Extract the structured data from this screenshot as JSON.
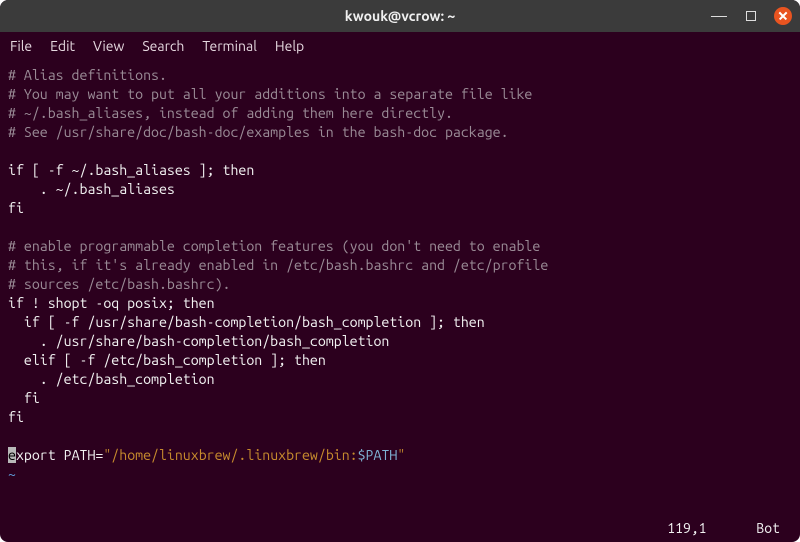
{
  "titlebar": {
    "title": "kwouk@vcrow: ~"
  },
  "menubar": {
    "items": [
      "File",
      "Edit",
      "View",
      "Search",
      "Terminal",
      "Help"
    ]
  },
  "editor": {
    "l0": "# Alias definitions.",
    "l1": "# You may want to put all your additions into a separate file like",
    "l2": "# ~/.bash_aliases, instead of adding them here directly.",
    "l3": "# See /usr/share/doc/bash-doc/examples in the bash-doc package.",
    "l4": "",
    "l5": "if [ -f ~/.bash_aliases ]; then",
    "l6": "    . ~/.bash_aliases",
    "l7": "fi",
    "l8": "",
    "l9": "# enable programmable completion features (you don't need to enable",
    "l10": "# this, if it's already enabled in /etc/bash.bashrc and /etc/profile",
    "l11": "# sources /etc/bash.bashrc).",
    "l12": "if ! shopt -oq posix; then",
    "l13": "  if [ -f /usr/share/bash-completion/bash_completion ]; then",
    "l14": "    . /usr/share/bash-completion/bash_completion",
    "l15": "  elif [ -f /etc/bash_completion ]; then",
    "l16": "    . /etc/bash_completion",
    "l17": "  fi",
    "l18": "fi",
    "l19": "",
    "export_line": {
      "cursor_char": "e",
      "rest1": "xport PATH=",
      "str1": "\"/home/linuxbrew/.linuxbrew/bin:",
      "var": "$PATH",
      "str2": "\""
    },
    "tilde": "~"
  },
  "status": {
    "position": "119,1",
    "scroll": "Bot"
  }
}
